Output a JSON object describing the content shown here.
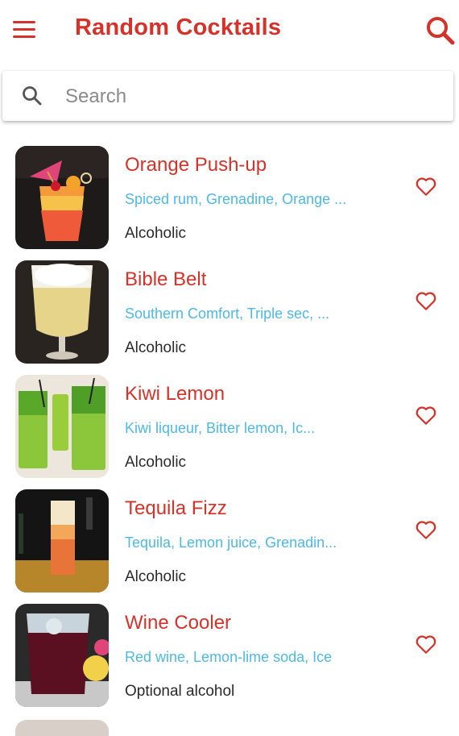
{
  "appbar": {
    "title": "Random Cocktails",
    "menu_icon": "hamburger-menu-icon",
    "search_icon": "search-icon",
    "accent_color": "#d5322a"
  },
  "search": {
    "placeholder": "Search",
    "value": ""
  },
  "cocktails": [
    {
      "name": "Orange Push-up",
      "ingredients": "Spiced rum, Grenadine, Orange ...",
      "category": "Alcoholic"
    },
    {
      "name": "Bible Belt",
      "ingredients": "Southern Comfort, Triple sec, ...",
      "category": "Alcoholic"
    },
    {
      "name": "Kiwi Lemon",
      "ingredients": "Kiwi liqueur, Bitter lemon, Ic...",
      "category": "Alcoholic"
    },
    {
      "name": "Tequila Fizz",
      "ingredients": "Tequila, Lemon juice, Grenadin...",
      "category": "Alcoholic"
    },
    {
      "name": "Wine Cooler",
      "ingredients": "Red wine, Lemon-lime soda, Ice",
      "category": "Optional alcohol"
    }
  ],
  "colors": {
    "name": "#d5322a",
    "ingredients": "#4fb8e6",
    "category": "#2a2a2a"
  },
  "favorite_icon": "heart-outline-icon"
}
